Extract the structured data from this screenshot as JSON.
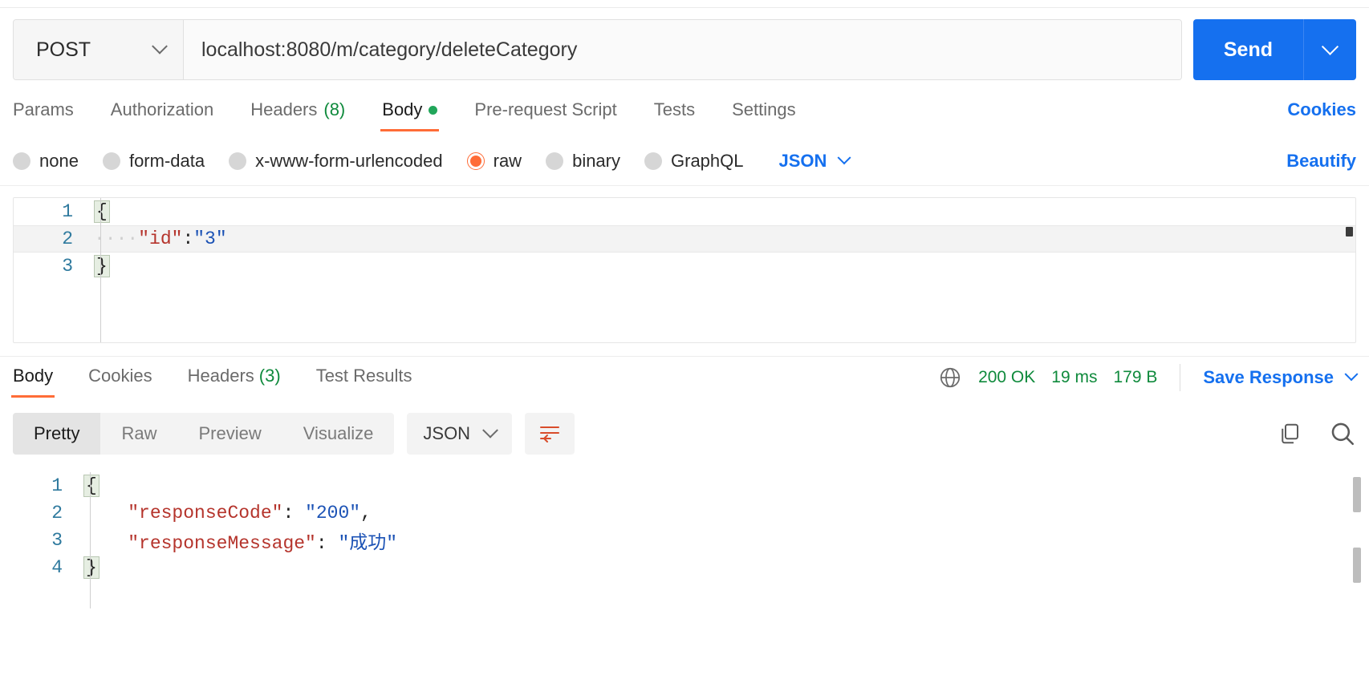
{
  "request": {
    "method": "POST",
    "url": "localhost:8080/m/category/deleteCategory",
    "send_label": "Send",
    "send_caret_icon": "chevron-down-icon",
    "method_caret_icon": "chevron-down-icon",
    "tabs": [
      {
        "label": "Params",
        "active": false
      },
      {
        "label": "Authorization",
        "active": false
      },
      {
        "label": "Headers",
        "count": "(8)",
        "active": false
      },
      {
        "label": "Body",
        "active": true,
        "dot": true
      },
      {
        "label": "Pre-request Script",
        "active": false
      },
      {
        "label": "Tests",
        "active": false
      },
      {
        "label": "Settings",
        "active": false
      }
    ],
    "cookies_label": "Cookies",
    "body_types": [
      {
        "label": "none",
        "selected": false
      },
      {
        "label": "form-data",
        "selected": false
      },
      {
        "label": "x-www-form-urlencoded",
        "selected": false
      },
      {
        "label": "raw",
        "selected": true
      },
      {
        "label": "binary",
        "selected": false
      },
      {
        "label": "GraphQL",
        "selected": false
      }
    ],
    "language": "JSON",
    "beautify_label": "Beautify",
    "body_lines": [
      {
        "num": "1",
        "open_brace": "{"
      },
      {
        "num": "2",
        "indent": "····",
        "key": "\"id\"",
        "colon": ":",
        "value": "\"3\"",
        "highlighted": true
      },
      {
        "num": "3",
        "close_brace": "}"
      }
    ]
  },
  "response": {
    "tabs": [
      {
        "label": "Body",
        "active": true
      },
      {
        "label": "Cookies",
        "active": false
      },
      {
        "label": "Headers",
        "count": "(3)",
        "active": false
      },
      {
        "label": "Test Results",
        "active": false
      }
    ],
    "globe_icon": "globe-icon",
    "status": "200 OK",
    "time": "19 ms",
    "size": "179 B",
    "save_response_label": "Save Response",
    "save_caret_icon": "chevron-down-icon",
    "view_modes": [
      {
        "label": "Pretty",
        "active": true
      },
      {
        "label": "Raw",
        "active": false
      },
      {
        "label": "Preview",
        "active": false
      },
      {
        "label": "Visualize",
        "active": false
      }
    ],
    "format": "JSON",
    "wrap_icon": "word-wrap-icon",
    "copy_icon": "copy-icon",
    "search_icon": "search-icon",
    "body_lines": [
      {
        "num": "1",
        "open_brace": "{"
      },
      {
        "num": "2",
        "indent": "    ",
        "key": "\"responseCode\"",
        "colon": ": ",
        "value": "\"200\"",
        "comma": ","
      },
      {
        "num": "3",
        "indent": "    ",
        "key": "\"responseMessage\"",
        "colon": ": ",
        "value": "\"成功\""
      },
      {
        "num": "4",
        "close_brace": "}"
      }
    ]
  },
  "colors": {
    "accent_orange": "#ff6c37",
    "link_blue": "#1570ef",
    "status_green": "#0f8a3c",
    "json_key_red": "#b5342c",
    "json_string_blue": "#1b52b5"
  }
}
